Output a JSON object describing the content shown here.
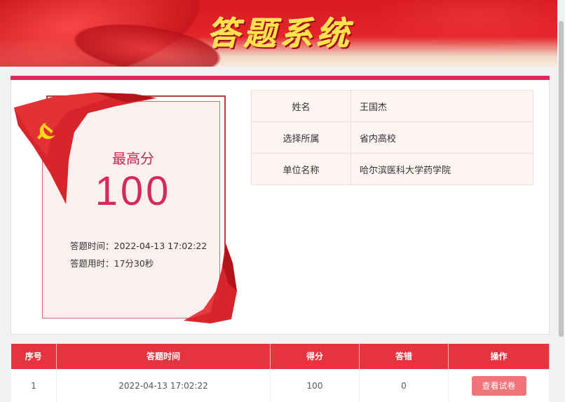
{
  "header": {
    "title": "答题系统"
  },
  "score_card": {
    "label": "最高分",
    "value": "100",
    "answer_time_label": "答题时间：2022-04-13 17:02:22",
    "duration_label": "答题用时：17分30秒"
  },
  "info": {
    "rows": [
      {
        "key": "姓名",
        "value": "王国杰"
      },
      {
        "key": "选择所属",
        "value": "省内高校"
      },
      {
        "key": "单位名称",
        "value": "哈尔滨医科大学药学院"
      }
    ]
  },
  "results": {
    "headers": [
      "序号",
      "答题时间",
      "得分",
      "答错",
      "操作"
    ],
    "rows": [
      {
        "index": "1",
        "time": "2022-04-13 17:02:22",
        "score": "100",
        "wrong": "0",
        "action": "查看试卷"
      }
    ]
  },
  "colors": {
    "primary_red": "#e5333f",
    "score_pink": "#d6285a",
    "button": "#f07478"
  },
  "icons": {
    "emblem": "hammer-sickle-icon"
  }
}
